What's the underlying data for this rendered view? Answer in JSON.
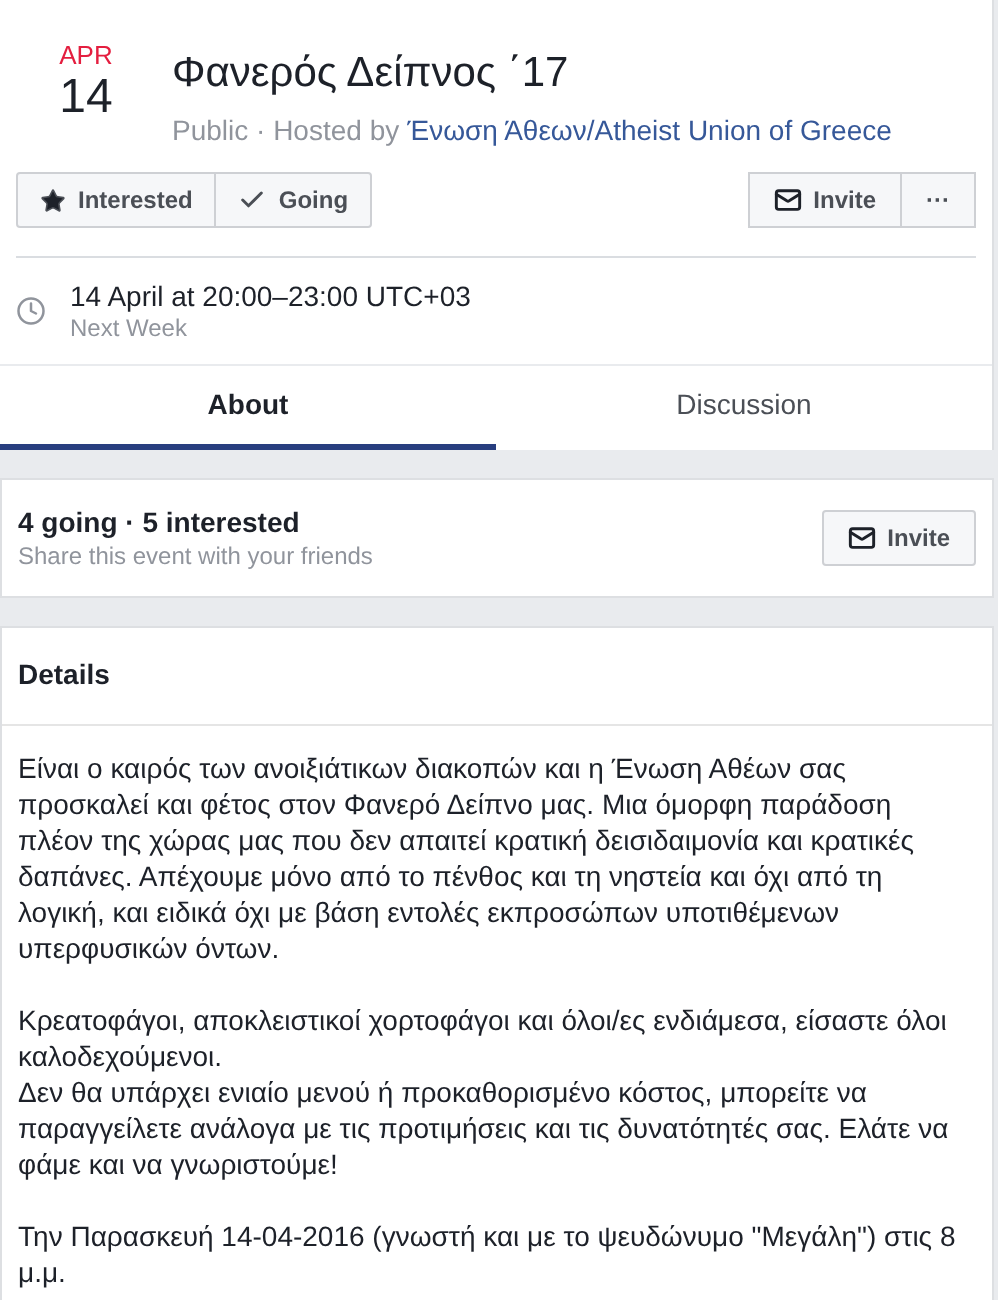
{
  "event": {
    "month": "APR",
    "day": "14",
    "title": "Φανερός Δείπνος ΄17",
    "privacy": "Public · Hosted by",
    "host": "Ένωση Άθεων/Atheist Union of Greece"
  },
  "actions": [
    {
      "kind": "star",
      "label": "Interested"
    },
    {
      "kind": "check",
      "label": "Going"
    }
  ],
  "right_actions": [
    {
      "kind": "invite",
      "label": "Invite"
    },
    {
      "kind": "more",
      "label": "···"
    }
  ],
  "time": {
    "text": "14 April at 20:00–23:00 UTC+03",
    "sub": "Next Week"
  },
  "tabs": [
    {
      "label": "About",
      "selected": true
    },
    {
      "label": "Discussion",
      "selected": false
    }
  ],
  "attendance": {
    "summary": "4 going · 5 interested",
    "hint": "Share this event with your friends",
    "button": "Invite"
  },
  "details": {
    "heading": "Details",
    "paragraphs": [
      [
        "Είναι ο καιρός των ανοιξιάτικων διακοπών και η Ένωση Αθέων σας προσκαλεί και φέτος στον Φανερό Δείπνο μας. Μια όμορφη παράδοση πλέον της χώρας μας που δεν απαιτεί κρατική δεισιδαιμονία και κρατικές δαπάνες. Απέχουμε μόνο από το πένθος και τη νηστεία και όχι από τη λογική, και ειδικά όχι με βάση εντολές εκπροσώπων υποτιθέμενων υπερφυσικών όντων."
      ],
      [
        "Κρεατοφάγοι, αποκλειστικοί χορτοφάγοι και όλοι/ες ενδιάμεσα, είσαστε όλοι καλοδεχούμενοι.",
        "Δεν θα υπάρχει ενιαίο μενού ή προκαθορισμένο κόστος, μπορείτε να παραγγείλετε ανάλογα με τις προτιμήσεις και τις δυνατότητές σας. Ελάτε να φάμε και να γνωριστούμε!"
      ],
      [
        "Την Παρασκευή 14-04-2016 (γνωστή και με το ψευδώνυμο \"Μεγάλη\") στις 8 μ.μ."
      ]
    ]
  }
}
